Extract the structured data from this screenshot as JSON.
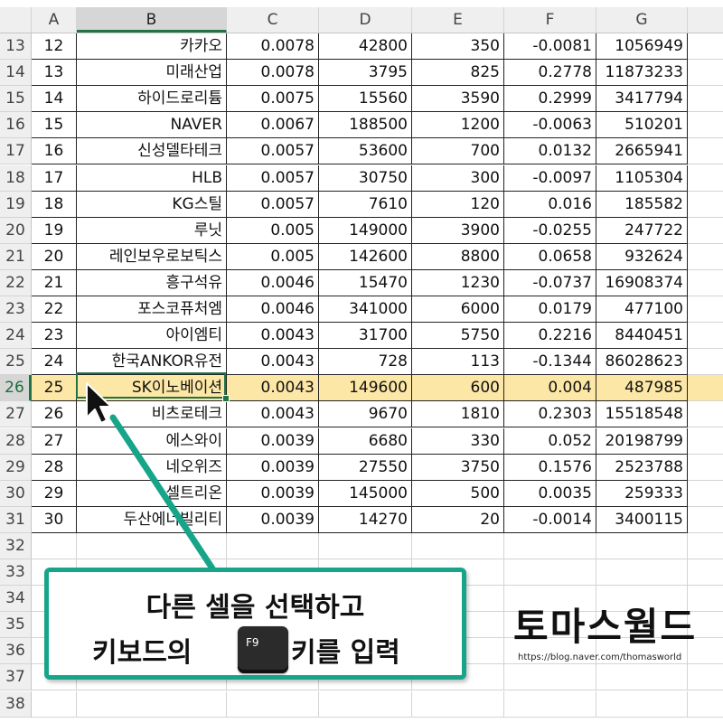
{
  "columns": [
    "A",
    "B",
    "C",
    "D",
    "E",
    "F",
    "G"
  ],
  "selected_column": "B",
  "rows": [
    {
      "num": "13",
      "a": "12",
      "b": "카카오",
      "c": "0.0078",
      "d": "42800",
      "e": "350",
      "f": "-0.0081",
      "g": "1056949"
    },
    {
      "num": "14",
      "a": "13",
      "b": "미래산업",
      "c": "0.0078",
      "d": "3795",
      "e": "825",
      "f": "0.2778",
      "g": "11873233"
    },
    {
      "num": "15",
      "a": "14",
      "b": "하이드로리튬",
      "c": "0.0075",
      "d": "15560",
      "e": "3590",
      "f": "0.2999",
      "g": "3417794"
    },
    {
      "num": "16",
      "a": "15",
      "b": "NAVER",
      "c": "0.0067",
      "d": "188500",
      "e": "1200",
      "f": "-0.0063",
      "g": "510201"
    },
    {
      "num": "17",
      "a": "16",
      "b": "신성델타테크",
      "c": "0.0057",
      "d": "53600",
      "e": "700",
      "f": "0.0132",
      "g": "2665941"
    },
    {
      "num": "18",
      "a": "17",
      "b": "HLB",
      "c": "0.0057",
      "d": "30750",
      "e": "300",
      "f": "-0.0097",
      "g": "1105304"
    },
    {
      "num": "19",
      "a": "18",
      "b": "KG스틸",
      "c": "0.0057",
      "d": "7610",
      "e": "120",
      "f": "0.016",
      "g": "185582"
    },
    {
      "num": "20",
      "a": "19",
      "b": "루닛",
      "c": "0.005",
      "d": "149000",
      "e": "3900",
      "f": "-0.0255",
      "g": "247722"
    },
    {
      "num": "21",
      "a": "20",
      "b": "레인보우로보틱스",
      "c": "0.005",
      "d": "142600",
      "e": "8800",
      "f": "0.0658",
      "g": "932624"
    },
    {
      "num": "22",
      "a": "21",
      "b": "흥구석유",
      "c": "0.0046",
      "d": "15470",
      "e": "1230",
      "f": "-0.0737",
      "g": "16908374"
    },
    {
      "num": "23",
      "a": "22",
      "b": "포스코퓨처엠",
      "c": "0.0046",
      "d": "341000",
      "e": "6000",
      "f": "0.0179",
      "g": "477100"
    },
    {
      "num": "24",
      "a": "23",
      "b": "아이엠티",
      "c": "0.0043",
      "d": "31700",
      "e": "5750",
      "f": "0.2216",
      "g": "8440451"
    },
    {
      "num": "25",
      "a": "24",
      "b": "한국ANKOR유전",
      "c": "0.0043",
      "d": "728",
      "e": "113",
      "f": "-0.1344",
      "g": "86028623"
    },
    {
      "num": "26",
      "a": "25",
      "b": "SK이노베이션",
      "c": "0.0043",
      "d": "149600",
      "e": "600",
      "f": "0.004",
      "g": "487985",
      "selected": true
    },
    {
      "num": "27",
      "a": "26",
      "b": "비츠로테크",
      "c": "0.0043",
      "d": "9670",
      "e": "1810",
      "f": "0.2303",
      "g": "15518548"
    },
    {
      "num": "28",
      "a": "27",
      "b": "에스와이",
      "c": "0.0039",
      "d": "6680",
      "e": "330",
      "f": "0.052",
      "g": "20198799"
    },
    {
      "num": "29",
      "a": "28",
      "b": "네오위즈",
      "c": "0.0039",
      "d": "27550",
      "e": "3750",
      "f": "0.1576",
      "g": "2523788"
    },
    {
      "num": "30",
      "a": "29",
      "b": "셀트리온",
      "c": "0.0039",
      "d": "145000",
      "e": "500",
      "f": "0.0035",
      "g": "259333"
    },
    {
      "num": "31",
      "a": "30",
      "b": "두산에너빌리티",
      "c": "0.0039",
      "d": "14270",
      "e": "20",
      "f": "-0.0014",
      "g": "3400115"
    },
    {
      "num": "32"
    },
    {
      "num": "33"
    },
    {
      "num": "34"
    },
    {
      "num": "35"
    },
    {
      "num": "36"
    },
    {
      "num": "37"
    },
    {
      "num": "38"
    }
  ],
  "callout": {
    "line1": "다른 셀을 선택하고",
    "line2_before": "키보드의",
    "key_label": "F9",
    "line2_after": "키를 입력"
  },
  "brand": {
    "name": "토마스월드",
    "url": "https://blog.naver.com/thomasworld"
  },
  "colors": {
    "selection_border": "#217346",
    "selected_row_fill": "#fde7a6",
    "callout_border": "#17a589"
  }
}
